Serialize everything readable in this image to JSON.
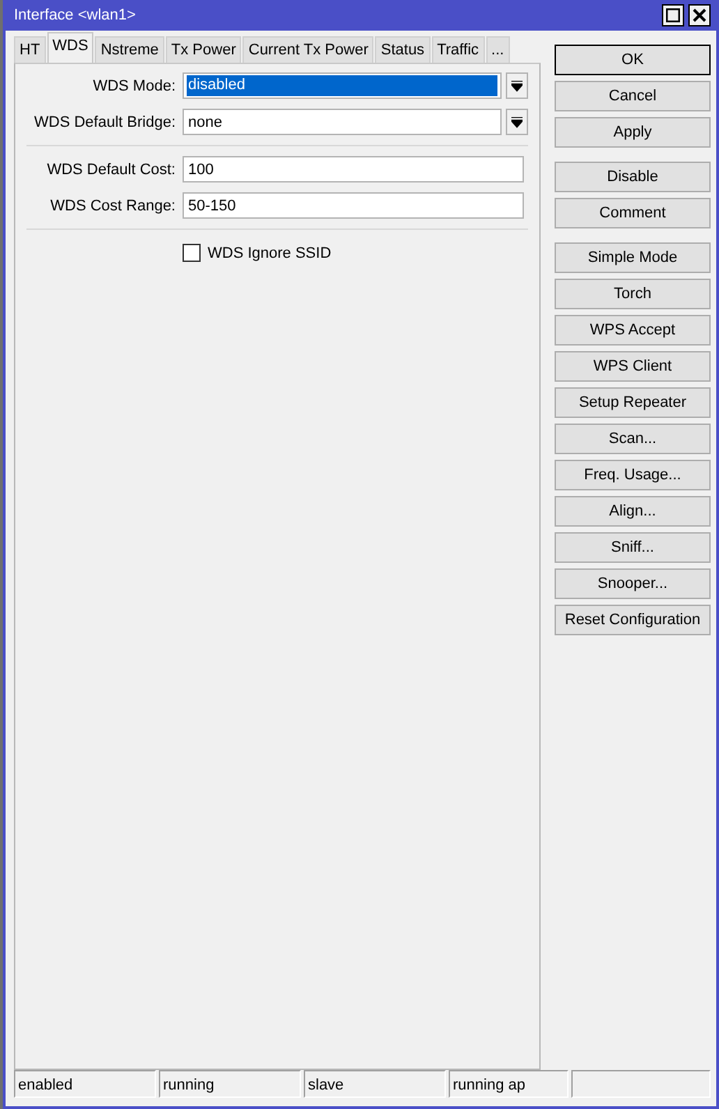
{
  "window": {
    "title": "Interface <wlan1>"
  },
  "tabs": [
    {
      "label": "HT",
      "selected": false
    },
    {
      "label": "WDS",
      "selected": true
    },
    {
      "label": "Nstreme",
      "selected": false
    },
    {
      "label": "Tx Power",
      "selected": false
    },
    {
      "label": "Current Tx Power",
      "selected": false
    },
    {
      "label": "Status",
      "selected": false
    },
    {
      "label": "Traffic",
      "selected": false
    },
    {
      "label": "...",
      "selected": false
    }
  ],
  "form": {
    "groups": [
      {
        "fields": [
          {
            "kind": "dropdown",
            "label": "WDS Mode:",
            "value": "disabled",
            "highlighted": true
          },
          {
            "kind": "dropdown",
            "label": "WDS Default Bridge:",
            "value": "none",
            "highlighted": false
          }
        ]
      },
      {
        "fields": [
          {
            "kind": "text",
            "label": "WDS Default Cost:",
            "value": "100",
            "highlighted": false
          },
          {
            "kind": "text",
            "label": "WDS Cost Range:",
            "value": "50-150",
            "highlighted": false
          }
        ]
      },
      {
        "fields": [
          {
            "kind": "checkbox",
            "label": "WDS Ignore SSID",
            "checked": false
          }
        ]
      }
    ]
  },
  "button_groups": [
    [
      "OK",
      "Cancel",
      "Apply"
    ],
    [
      "Disable",
      "Comment"
    ],
    [
      "Simple Mode",
      "Torch",
      "WPS Accept",
      "WPS Client",
      "Setup Repeater",
      "Scan...",
      "Freq. Usage...",
      "Align...",
      "Sniff...",
      "Snooper...",
      "Reset Configuration"
    ]
  ],
  "status_bar": [
    "enabled",
    "running",
    "slave",
    "running ap"
  ]
}
